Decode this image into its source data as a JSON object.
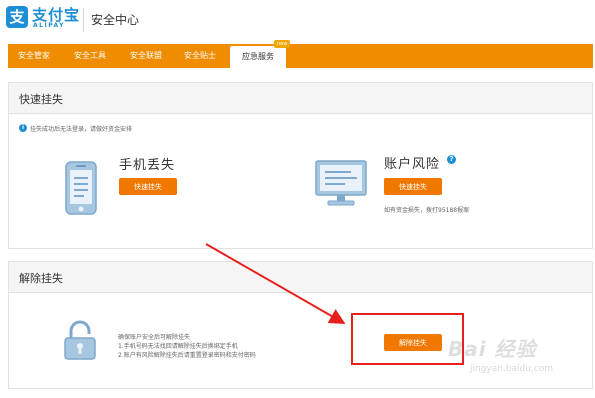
{
  "header": {
    "logo_glyph": "支",
    "logo_text": "支付宝",
    "logo_sub": "ALIPAY",
    "title": "安全中心"
  },
  "nav": {
    "items": [
      {
        "label": "安全管家"
      },
      {
        "label": "安全工具"
      },
      {
        "label": "安全联盟"
      },
      {
        "label": "安全贴士"
      },
      {
        "label": "应急服务",
        "active": true
      }
    ],
    "badge": "new"
  },
  "quick_freeze": {
    "title": "快速挂失",
    "notice_icon": "i",
    "notice": "挂失成功后无法登录，请做好资金安排",
    "phone_lost": {
      "icon": "phone-icon",
      "label": "手机丢失",
      "button": "快速挂失"
    },
    "account_risk": {
      "icon": "monitor-icon",
      "label": "账户风险",
      "help_icon": "?",
      "button": "快速挂失",
      "note": "如有资金损失，拨打95188报案"
    }
  },
  "unfreeze": {
    "title": "解除挂失",
    "icon": "lock-icon",
    "desc": [
      "确保账户安全后可解除挂失",
      "1.手机号码无法找回请解除挂失后换绑定手机",
      "2.账户有风险解除挂失后请重置登录密码和支付密码"
    ],
    "button": "解除挂失"
  },
  "watermark": {
    "logo": "Bai 经验",
    "url": "jingyan.baidu.com"
  },
  "colors": {
    "brand_blue": "#1e8fd6",
    "nav_orange": "#f08c00",
    "button_orange": "#f07800",
    "annotation_red": "#e8201c"
  }
}
